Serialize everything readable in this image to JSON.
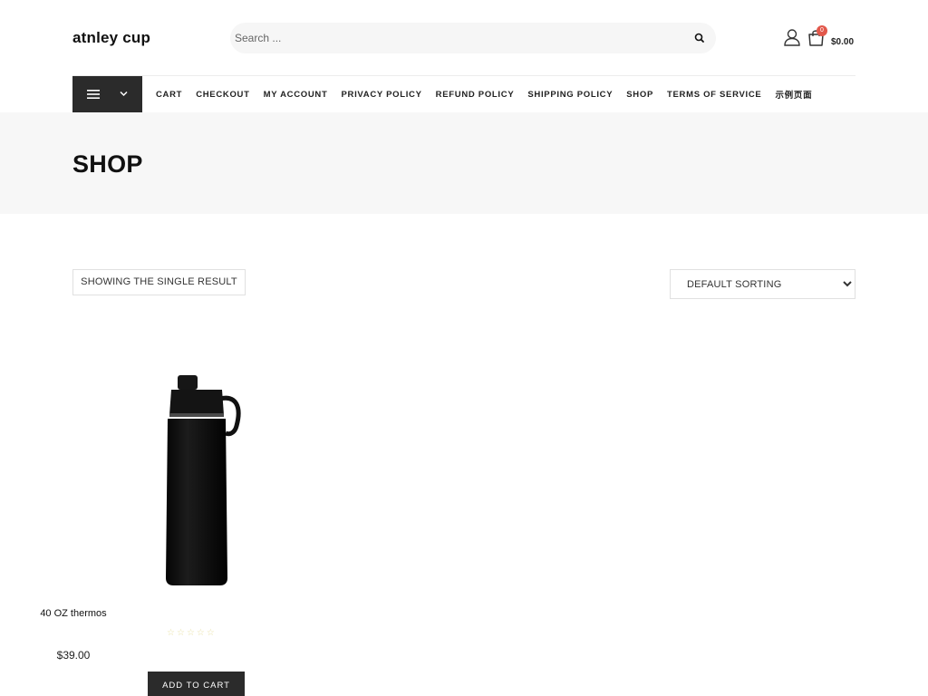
{
  "header": {
    "site_title": "atnley cup",
    "search_placeholder": "Search ...",
    "cart_count": "0",
    "cart_total": "$0.00"
  },
  "nav": {
    "items": [
      {
        "label": "CART"
      },
      {
        "label": "CHECKOUT"
      },
      {
        "label": "MY ACCOUNT"
      },
      {
        "label": "PRIVACY POLICY"
      },
      {
        "label": "REFUND POLICY"
      },
      {
        "label": "SHIPPING POLICY"
      },
      {
        "label": "SHOP"
      },
      {
        "label": "TERMS OF SERVICE"
      },
      {
        "label": "示例页面"
      }
    ]
  },
  "page": {
    "title": "SHOP",
    "result_count": "SHOWING THE SINGLE RESULT",
    "sorting": {
      "selected": "DEFAULT SORTING"
    }
  },
  "products": [
    {
      "name": "40 OZ thermos",
      "price": "$39.00",
      "rating_stars": 5,
      "button_label": "ADD TO CART"
    }
  ],
  "colors": {
    "accent_dark": "#2b2b2b",
    "hero_bg": "#f7f7f7",
    "badge": "#e2584b"
  }
}
